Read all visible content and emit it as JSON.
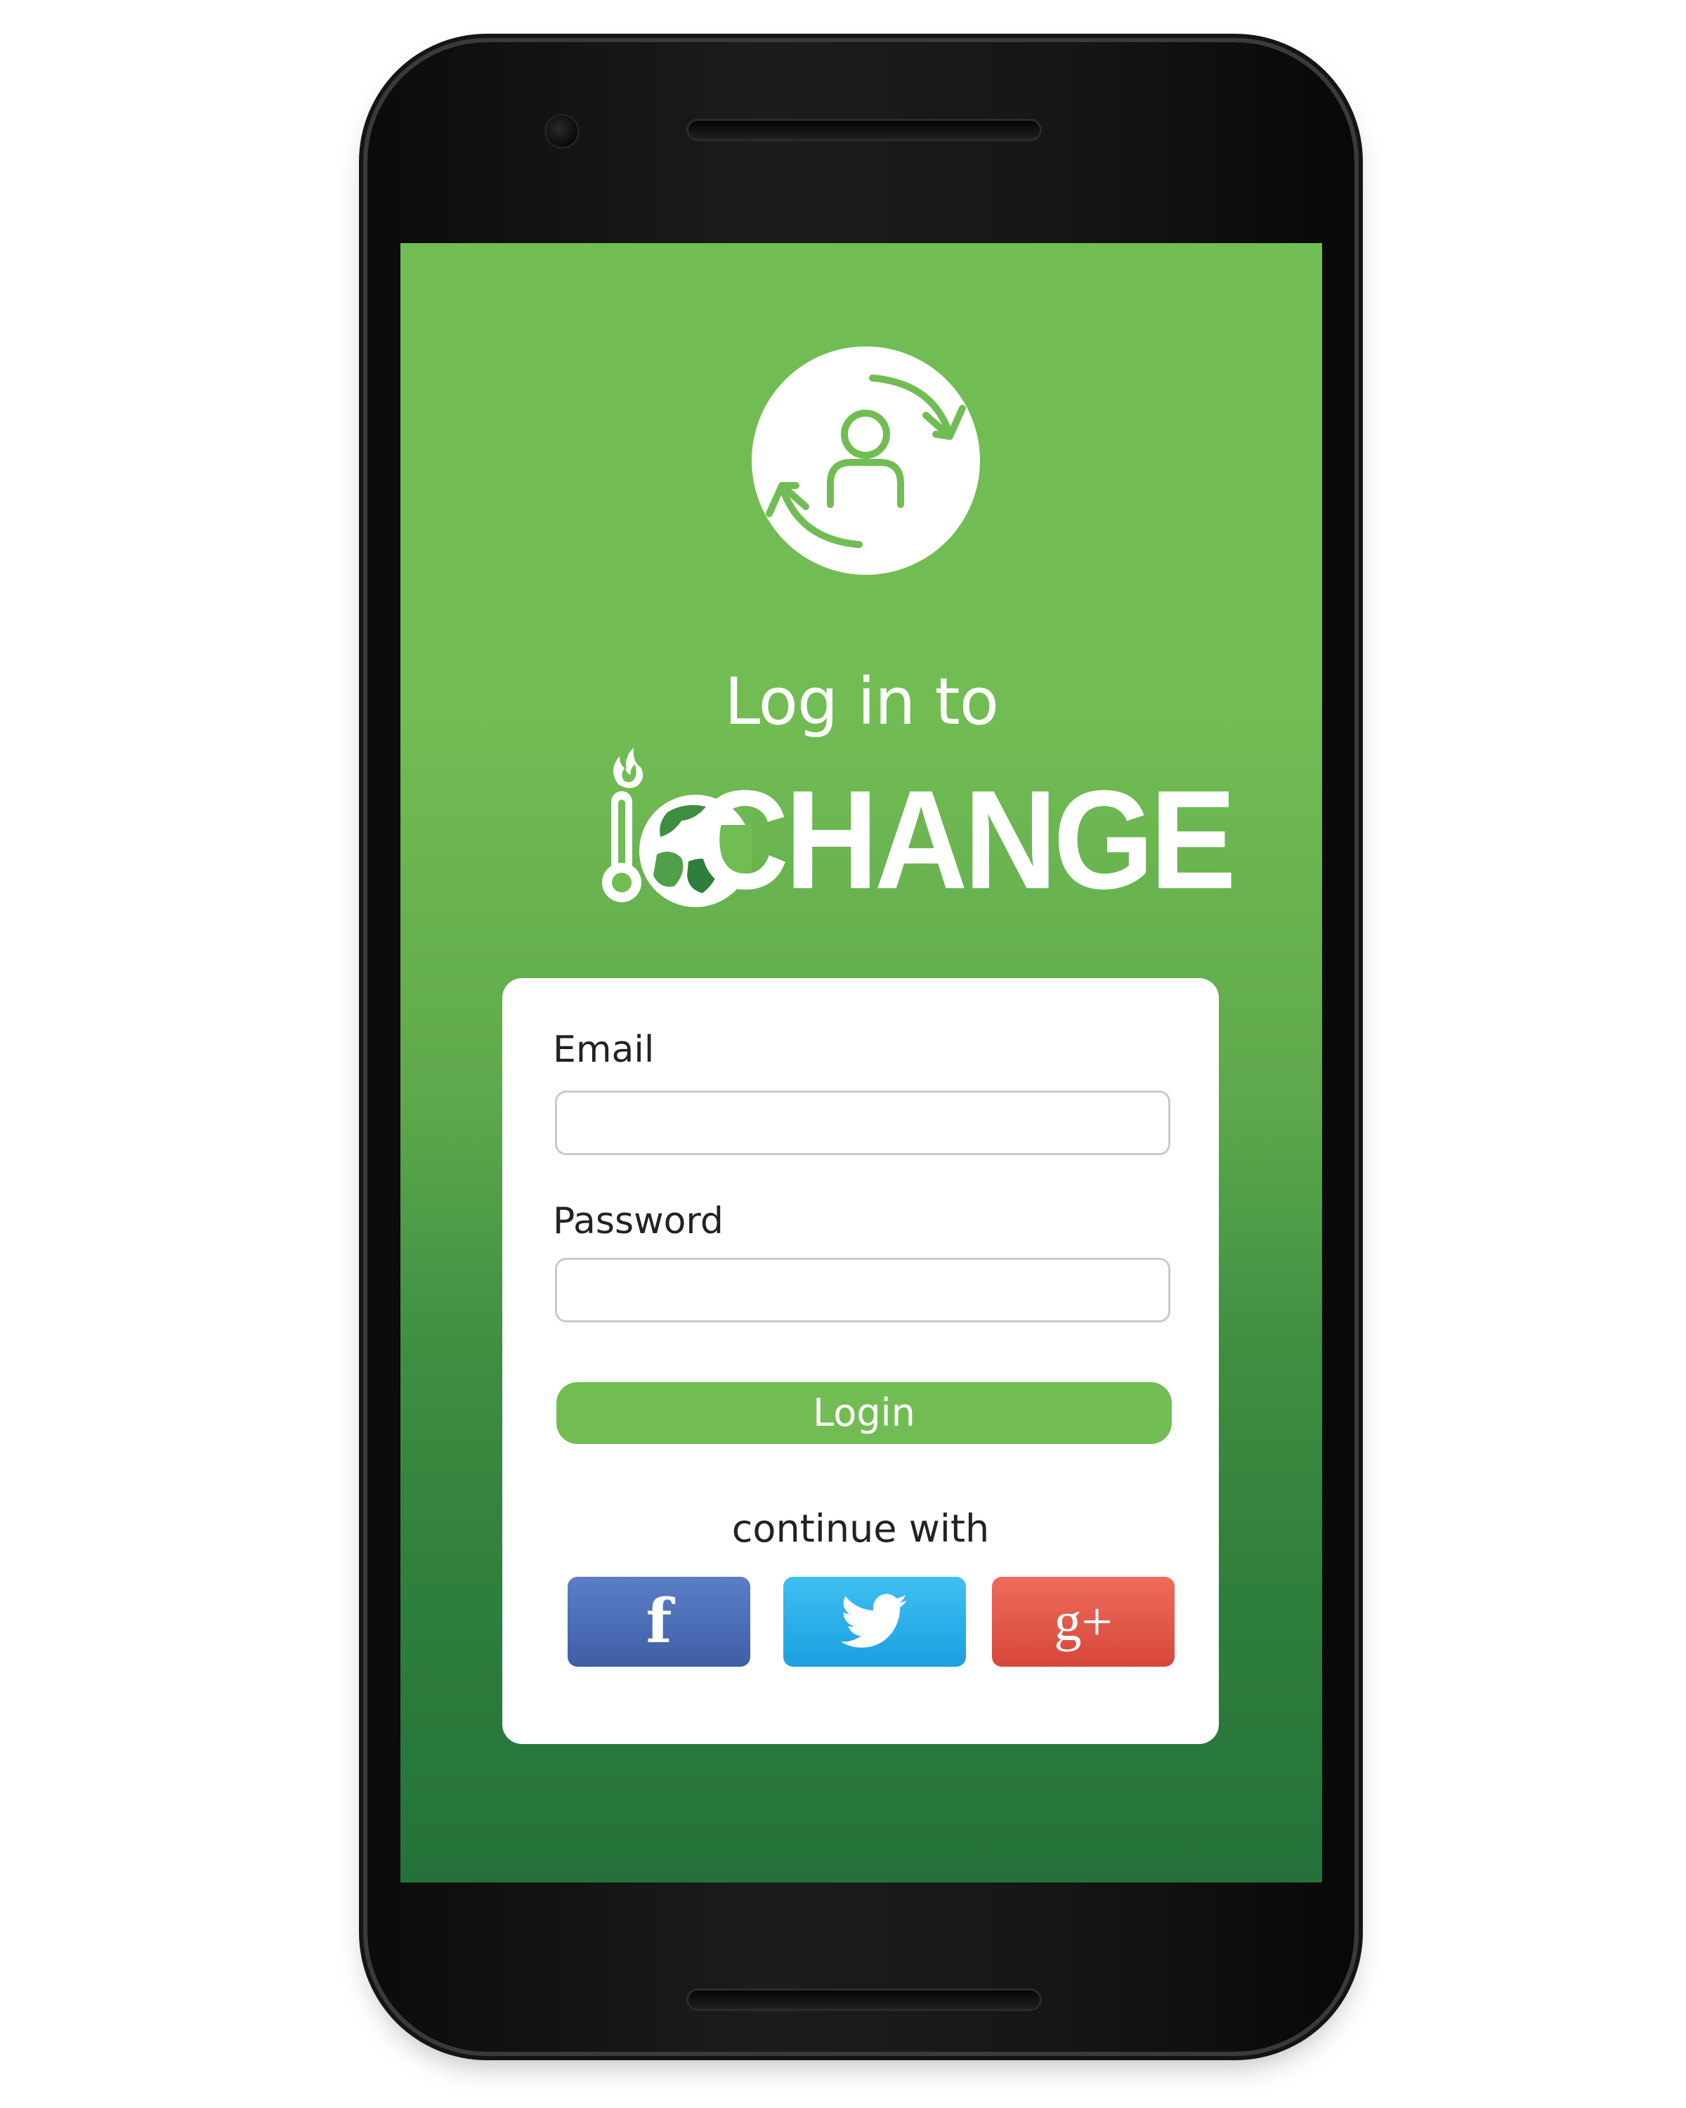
{
  "app": {
    "heading": "Log in to",
    "brand_name": "CHANGE",
    "brand_mark_icon": "thermometer-globe-icon",
    "logo_icon": "user-sync-icon",
    "colors": {
      "primary_green": "#72bd53",
      "dark_green": "#24723a",
      "facebook": "#3e5ea6",
      "twitter": "#1a9fe0",
      "google": "#d6473a"
    }
  },
  "form": {
    "email_label": "Email",
    "email_value": "",
    "email_placeholder": "",
    "password_label": "Password",
    "password_value": "",
    "password_placeholder": "",
    "login_label": "Login"
  },
  "social": {
    "continue_label": "continue with",
    "providers": [
      {
        "name": "facebook",
        "glyph": "f",
        "icon": "facebook-icon"
      },
      {
        "name": "twitter",
        "glyph": "",
        "icon": "twitter-bird-icon"
      },
      {
        "name": "google-plus",
        "glyph": "g+",
        "icon": "google-plus-icon"
      }
    ]
  }
}
